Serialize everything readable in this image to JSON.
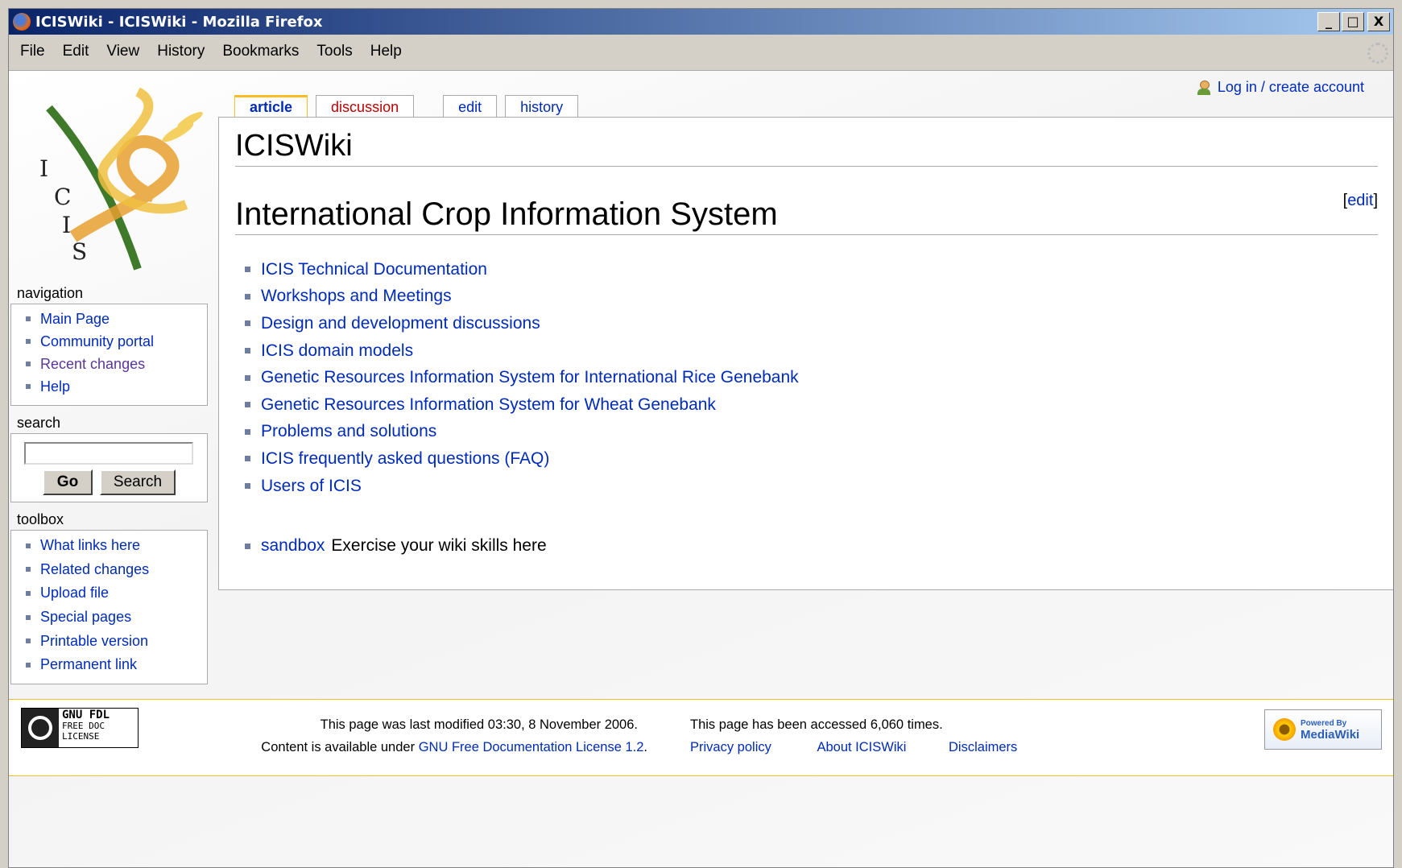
{
  "window": {
    "title": "ICISWiki - ICISWiki - Mozilla Firefox",
    "controls": [
      "_",
      "□",
      "X"
    ]
  },
  "menu": [
    "File",
    "Edit",
    "View",
    "History",
    "Bookmarks",
    "Tools",
    "Help"
  ],
  "personal": {
    "login": "Log in / create account"
  },
  "tabs": {
    "article": "article",
    "discussion": "discussion",
    "edit": "edit",
    "history": "history"
  },
  "logo": {
    "letters": [
      "I",
      "C",
      "I",
      "S"
    ]
  },
  "page": {
    "title": "ICISWiki",
    "section_title": "International Crop Information System",
    "edit_open": "[",
    "edit_link": "edit",
    "edit_close": "]",
    "links": [
      "ICIS Technical Documentation",
      "Workshops and Meetings",
      "Design and development discussions",
      "ICIS domain models",
      "Genetic Resources Information System for International Rice Genebank",
      "Genetic Resources Information System for Wheat Genebank",
      "Problems and solutions",
      "ICIS frequently asked questions (FAQ)",
      "Users of ICIS"
    ],
    "sandbox": {
      "link": "sandbox",
      "text": "Exercise your wiki skills here"
    }
  },
  "navigation": {
    "heading": "navigation",
    "items": [
      "Main Page",
      "Community portal",
      "Recent changes",
      "Help"
    ]
  },
  "search": {
    "heading": "search",
    "value": "",
    "go_label": "Go",
    "search_label": "Search"
  },
  "toolbox": {
    "heading": "toolbox",
    "items": [
      "What links here",
      "Related changes",
      "Upload file",
      "Special pages",
      "Printable version",
      "Permanent link"
    ]
  },
  "footer": {
    "gfdl_line1": "GNU FDL",
    "gfdl_line2": "FREE DOC",
    "gfdl_line3": "LICENSE",
    "last_modified": "This page was last modified 03:30, 8 November 2006.",
    "content_prefix": "Content is available under",
    "license_link": "GNU Free Documentation License 1.2",
    "license_suffix": ".",
    "accessed": "This page has been accessed 6,060 times.",
    "privacy": "Privacy policy",
    "about": "About ICISWiki",
    "disclaimers": "Disclaimers",
    "powered_small": "Powered By",
    "powered_big": "MediaWiki"
  },
  "colors": {
    "link": "#002bb8",
    "new_link": "#ba0000",
    "visited": "#5a3696",
    "accent": "#fabd23"
  }
}
